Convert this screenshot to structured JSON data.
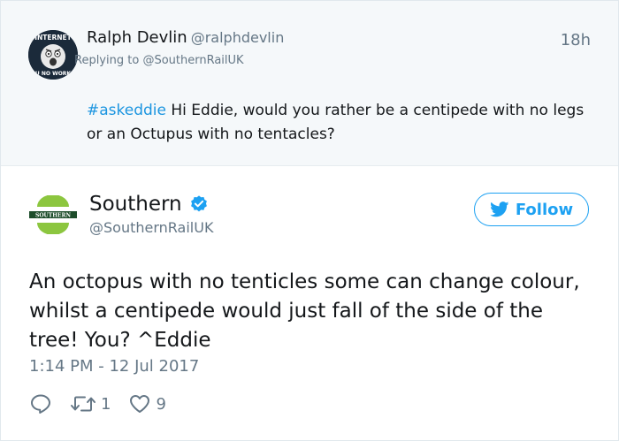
{
  "parent_tweet": {
    "author_name": "Ralph Devlin",
    "author_handle": "@ralphdevlin",
    "time": "18h",
    "replying_prefix": "Replying to ",
    "replying_to": "@SouthernRailUK",
    "hashtag": "#askeddie",
    "text": " Hi Eddie, would you rather be a centipede with no legs or an Octupus with no tentacles?",
    "avatar": {
      "icon": "internet-meme-face-avatar",
      "top_text": "INTERNET",
      "bottom_text": "U NO WORK"
    }
  },
  "tweet": {
    "author_name": "Southern",
    "author_handle": "@SouthernRailUK",
    "verified_icon": "verified-badge-icon",
    "follow_label": "Follow",
    "text": "An octopus with no tenticles some can change colour, whilst a centipede would just fall of the side of the tree! You? ^Eddie",
    "date": "1:14 PM - 12 Jul 2017",
    "avatar": {
      "icon": "southern-rail-logo",
      "text": "SOUTHERN"
    },
    "actions": {
      "reply_icon": "reply-icon",
      "retweet_icon": "retweet-icon",
      "retweet_count": "1",
      "like_icon": "heart-icon",
      "like_count": "9"
    }
  },
  "colors": {
    "link_blue": "#1b95e0",
    "twitter_blue": "#1da1f2",
    "muted_gray": "#657786",
    "parent_bg": "#f5f8fa",
    "southern_green": "#8cc63f",
    "southern_dark": "#1e4d2b"
  }
}
